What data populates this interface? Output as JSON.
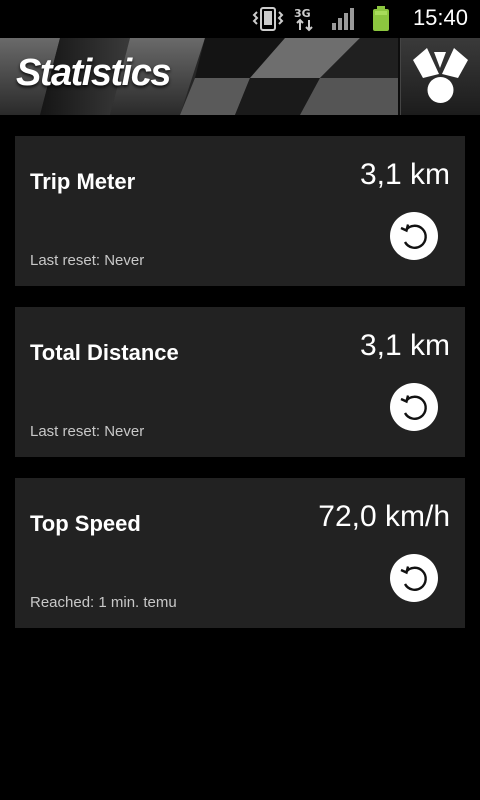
{
  "status_bar": {
    "time": "15:40",
    "icons": [
      "vibrate-icon",
      "3g-data-icon",
      "signal-icon",
      "battery-icon"
    ]
  },
  "header": {
    "title": "Statistics",
    "logo_icon": "app-logo-icon"
  },
  "cards": [
    {
      "title": "Trip Meter",
      "value": "3,1 km",
      "subtitle": "Last reset: Never",
      "action_icon": "reset-icon"
    },
    {
      "title": "Total Distance",
      "value": "3,1 km",
      "subtitle": "Last reset: Never",
      "action_icon": "reset-icon"
    },
    {
      "title": "Top Speed",
      "value": "72,0 km/h",
      "subtitle": "Reached: 1 min. temu",
      "action_icon": "reset-icon"
    }
  ],
  "colors": {
    "background": "#000000",
    "card": "#222222",
    "battery": "#8cc63f"
  }
}
